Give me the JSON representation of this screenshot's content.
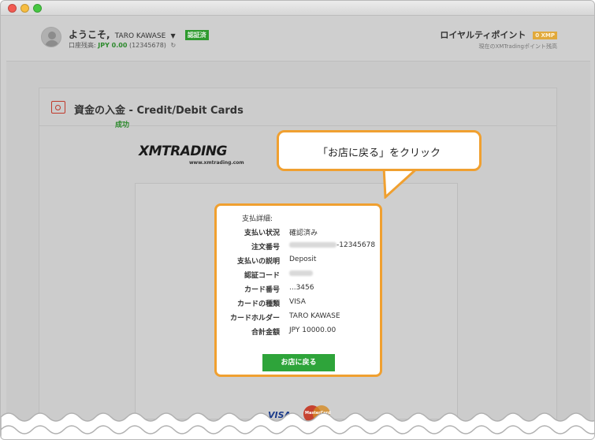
{
  "header": {
    "welcome": "ようこそ,",
    "user_name": "TARO KAWASE",
    "verified_badge": "認証済",
    "balance_label": "口座残高:",
    "balance_amount": "JPY 0.00",
    "account_id": "(12345678)",
    "loyalty_title": "ロイヤルティポイント",
    "loyalty_points": "0 XMP",
    "loyalty_subtitle": "現在のXMTradingポイント残高"
  },
  "panel": {
    "title": "資金の入金 - Credit/Debit Cards",
    "logo_text": "XMTRADING",
    "logo_url": "www.xmtrading.com",
    "success_label": "成功"
  },
  "payment": {
    "heading": "支払詳細:",
    "rows": [
      {
        "label": "支払い状況",
        "value": "確認済み"
      },
      {
        "label": "注文番号",
        "value": "-12345678"
      },
      {
        "label": "支払いの説明",
        "value": "Deposit"
      },
      {
        "label": "認証コード",
        "value": ""
      },
      {
        "label": "カード番号",
        "value": "...3456"
      },
      {
        "label": "カードの種類",
        "value": "VISA"
      },
      {
        "label": "カードホルダー",
        "value": "TARO KAWASE"
      },
      {
        "label": "合計金額",
        "value": "JPY 10000.00"
      }
    ],
    "back_button": "お店に戻る"
  },
  "card_logos": {
    "visa": "VISA",
    "mastercard": "MasterCard"
  },
  "callout": {
    "text": "「お店に戻る」をクリック"
  },
  "colors": {
    "accent_orange": "#f0a030",
    "success_green": "#2ea43a",
    "alert_red": "#c0392b"
  }
}
